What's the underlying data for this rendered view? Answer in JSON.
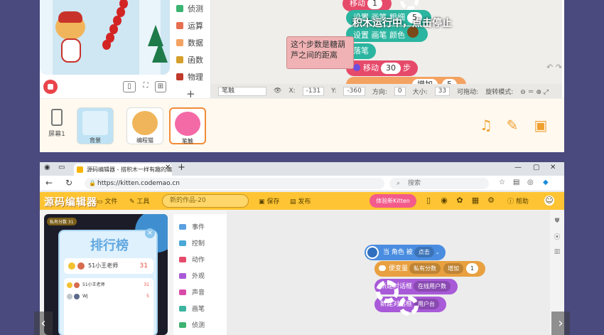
{
  "top": {
    "categories": [
      {
        "label": "侦测",
        "color": "#3cb371"
      },
      {
        "label": "运算",
        "color": "#e76f51"
      },
      {
        "label": "数据",
        "color": "#f4a261"
      },
      {
        "label": "函数",
        "color": "#d4a02b"
      },
      {
        "label": "物理",
        "color": "#c0392b"
      }
    ],
    "add_label": "+",
    "blocks": {
      "move_label": "移动",
      "move_value": "1",
      "pen_size_label": "设置 画笔 粗细",
      "pen_size_value": "5",
      "pen_color_label": "设置 画笔 颜色",
      "pen_down_label": "落笔",
      "move2_label": "移动",
      "move2_value": "30",
      "move2_unit": "步",
      "increase_label": "增加",
      "increase_value": "5"
    },
    "run_overlay": "积木运行中，点击停止",
    "comment": "这个步数是糖葫芦之间的距离",
    "props": {
      "sprite_name": "笔触",
      "x_label": "X:",
      "x_value": "-131",
      "y_label": "Y:",
      "y_value": "-360",
      "direction_label": "方向:",
      "direction_value": "0",
      "size_label": "大小:",
      "size_value": "33",
      "draggable_label": "可拖动:",
      "rotation_label": "旋转模式:"
    },
    "screen_label": "屏幕1",
    "sprites": [
      {
        "name": "背景",
        "color": "#bfe3f4"
      },
      {
        "name": "编程猫",
        "color": "#fff1e0"
      },
      {
        "name": "笔触",
        "color": "#f46aa6"
      }
    ]
  },
  "browser": {
    "tab_title": "源码编辑器 - 搭积木一样有趣的编",
    "url": "https://kitten.codemao.cn",
    "search_placeholder": "搜索"
  },
  "app": {
    "logo": "源码编辑器",
    "menu_file": "文件",
    "menu_tools": "工具",
    "project_name": "新的作品-20",
    "save": "保存",
    "publish": "发布",
    "try_new": "体验新Kitten",
    "help": "帮助",
    "score_chip": "私有分数  31",
    "leaderboard": {
      "title": "排行榜",
      "close": "×",
      "top_name": "51小王老师",
      "top_score": "31",
      "rows": [
        {
          "name": "51小王老师",
          "score": "31",
          "medal": "#f2c230"
        },
        {
          "name": "WJ",
          "score": "5",
          "medal": "#bfc6cc"
        }
      ]
    },
    "categories": [
      {
        "label": "事件",
        "color": "#5aa0e0"
      },
      {
        "label": "控制",
        "color": "#48a8d8"
      },
      {
        "label": "动作",
        "color": "#e64a6a"
      },
      {
        "label": "外观",
        "color": "#a85ad8"
      },
      {
        "label": "声音",
        "color": "#d84aa8"
      },
      {
        "label": "画笔",
        "color": "#3cb4a0"
      },
      {
        "label": "侦测",
        "color": "#3cb371"
      }
    ],
    "blocks": {
      "when_clicked": "当 角色 被",
      "when_clicked_value": "点击",
      "cloud_var": "便变量",
      "cloud_var_name": "私有分数",
      "cloud_op": "增加",
      "cloud_value": "1",
      "dialog1": "新建对话框",
      "dialog1_value": "在线用户数",
      "dialog2": "新建对话框",
      "dialog2_value": "用户台"
    }
  },
  "pager": {
    "prev": "‹",
    "next": "›"
  }
}
